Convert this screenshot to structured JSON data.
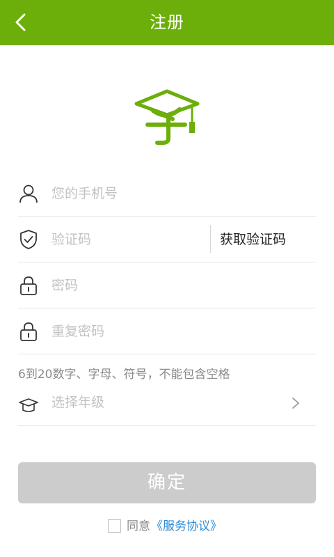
{
  "header": {
    "title": "注册"
  },
  "form": {
    "phone_placeholder": "您的手机号",
    "code_placeholder": "验证码",
    "get_code_label": "获取验证码",
    "password_placeholder": "密码",
    "password_confirm_placeholder": "重复密码",
    "password_hint": "6到20数字、字母、符号，不能包含空格",
    "grade_label": "选择年级"
  },
  "actions": {
    "confirm_label": "确定"
  },
  "agreement": {
    "prefix": "同意",
    "link_label": "《服务协议》"
  },
  "colors": {
    "brand": "#6cae0a",
    "link": "#2a8bd6",
    "disabled_button": "#cccccc"
  },
  "icons": [
    "back-arrow-icon",
    "logo-icon",
    "user-icon",
    "shield-check-icon",
    "lock-icon",
    "graduation-cap-icon",
    "chevron-right-icon"
  ]
}
